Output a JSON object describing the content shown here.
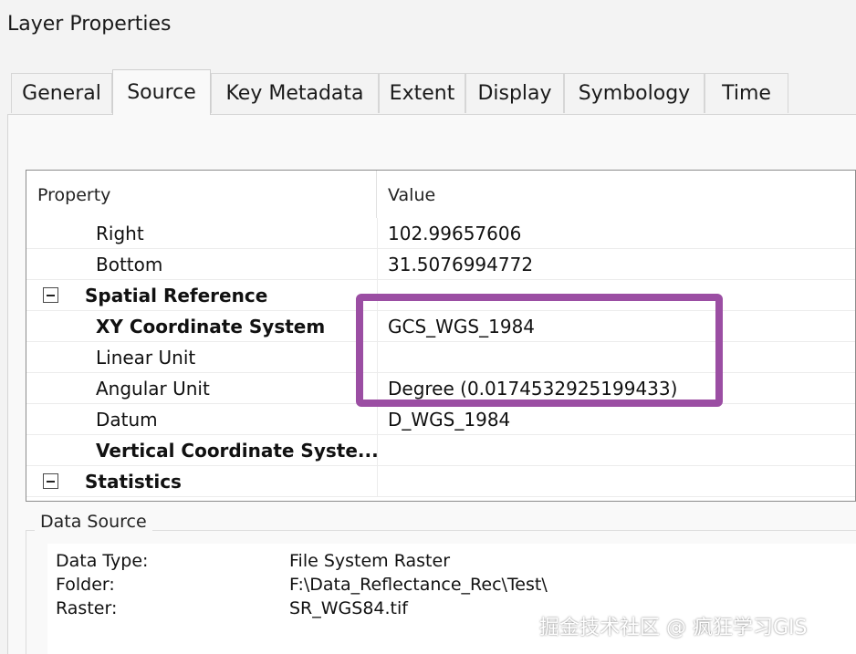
{
  "window": {
    "title": "Layer Properties"
  },
  "tabs": [
    {
      "label": "General",
      "active": false
    },
    {
      "label": "Source",
      "active": true
    },
    {
      "label": "Key Metadata",
      "active": false
    },
    {
      "label": "Extent",
      "active": false
    },
    {
      "label": "Display",
      "active": false
    },
    {
      "label": "Symbology",
      "active": false
    },
    {
      "label": "Time",
      "active": false
    }
  ],
  "grid": {
    "headers": {
      "property": "Property",
      "value": "Value"
    },
    "rows": [
      {
        "property": "Right",
        "value": "102.99657606"
      },
      {
        "property": "Bottom",
        "value": "31.5076994772"
      },
      {
        "property": "Spatial Reference",
        "value": "",
        "group": true,
        "expander": "minus"
      },
      {
        "property": "XY Coordinate System",
        "value": "GCS_WGS_1984",
        "bold": true
      },
      {
        "property": "Linear Unit",
        "value": ""
      },
      {
        "property": "Angular Unit",
        "value": "Degree (0.0174532925199433)"
      },
      {
        "property": "Datum",
        "value": "D_WGS_1984"
      },
      {
        "property": "Vertical Coordinate Syste...",
        "value": "",
        "bold": true
      },
      {
        "property": "Statistics",
        "value": "",
        "group": true,
        "expander": "minus"
      }
    ]
  },
  "highlight": {
    "color": "#9b4ea3"
  },
  "data_source": {
    "legend": "Data Source",
    "rows": [
      {
        "label": "Data Type:",
        "value": "File System Raster"
      },
      {
        "label": "Folder:",
        "value": "F:\\Data_Reflectance_Rec\\Test\\"
      },
      {
        "label": "Raster:",
        "value": "SR_WGS84.tif"
      }
    ]
  },
  "watermark": {
    "text": "掘金技术社区 @ 疯狂学习GIS"
  }
}
